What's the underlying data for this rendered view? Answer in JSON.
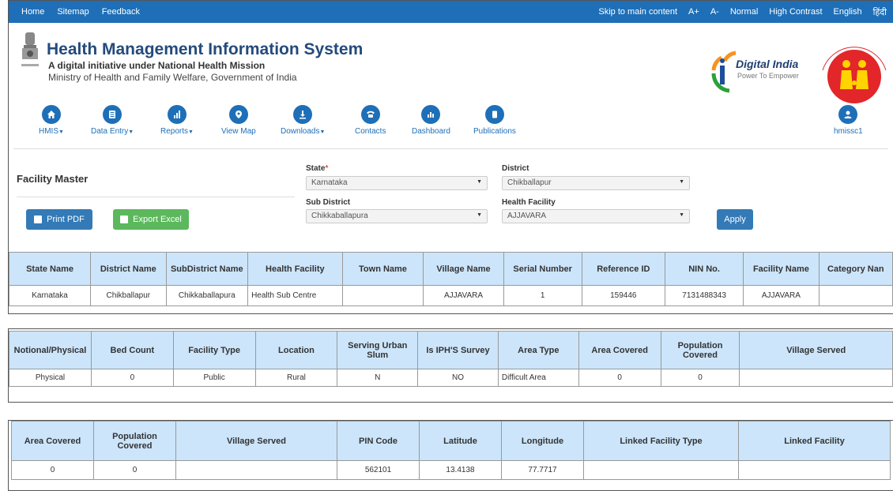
{
  "topbar": {
    "left": [
      "Home",
      "Sitemap",
      "Feedback"
    ],
    "right": [
      "Skip to main content",
      "A+",
      "A-",
      "Normal",
      "High Contrast",
      "English",
      "हिंदी"
    ]
  },
  "header": {
    "title": "Health Management Information System",
    "subtitle": "A digital initiative under National Health Mission",
    "ministry": "Ministry of Health and Family Welfare, Government of India",
    "digital_india": "Digital India",
    "digital_india_tagline": "Power To Empower"
  },
  "nav": {
    "items": [
      "HMIS",
      "Data Entry",
      "Reports",
      "View Map",
      "Downloads",
      "Contacts",
      "Dashboard",
      "Publications"
    ],
    "user": "hmissc1"
  },
  "form": {
    "title": "Facility Master",
    "state_label": "State",
    "state_value": "Karnataka",
    "district_label": "District",
    "district_value": "Chikballapur",
    "subdistrict_label": "Sub District",
    "subdistrict_value": "Chikkaballapura",
    "facility_label": "Health Facility",
    "facility_value": "AJJAVARA",
    "print_label": "Print PDF",
    "excel_label": "Export Excel",
    "apply_label": "Apply"
  },
  "table1": {
    "headers": [
      "State Name",
      "District Name",
      "SubDistrict Name",
      "Health Facility",
      "Town Name",
      "Village Name",
      "Serial Number",
      "Reference ID",
      "NIN No.",
      "Facility Name",
      "Category Nan"
    ],
    "row": [
      "Karnataka",
      "Chikballapur",
      "Chikkaballapura",
      "Health Sub Centre",
      "",
      "AJJAVARA",
      "1",
      "159446",
      "7131488343",
      "AJJAVARA",
      ""
    ]
  },
  "table2": {
    "headers": [
      "Notional/Physical",
      "Bed Count",
      "Facility Type",
      "Location",
      "Serving Urban Slum",
      "Is IPH'S Survey",
      "Area Type",
      "Area Covered",
      "Population Covered",
      "Village Served"
    ],
    "row": [
      "Physical",
      "0",
      "Public",
      "Rural",
      "N",
      "NO",
      "Difficult Area",
      "0",
      "0",
      ""
    ]
  },
  "table3": {
    "headers": [
      "Area Covered",
      "Population Covered",
      "Village Served",
      "PIN Code",
      "Latitude",
      "Longitude",
      "Linked Facility Type",
      "Linked Facility"
    ],
    "row": [
      "0",
      "0",
      "",
      "562101",
      "13.4138",
      "77.7717",
      "",
      ""
    ]
  }
}
